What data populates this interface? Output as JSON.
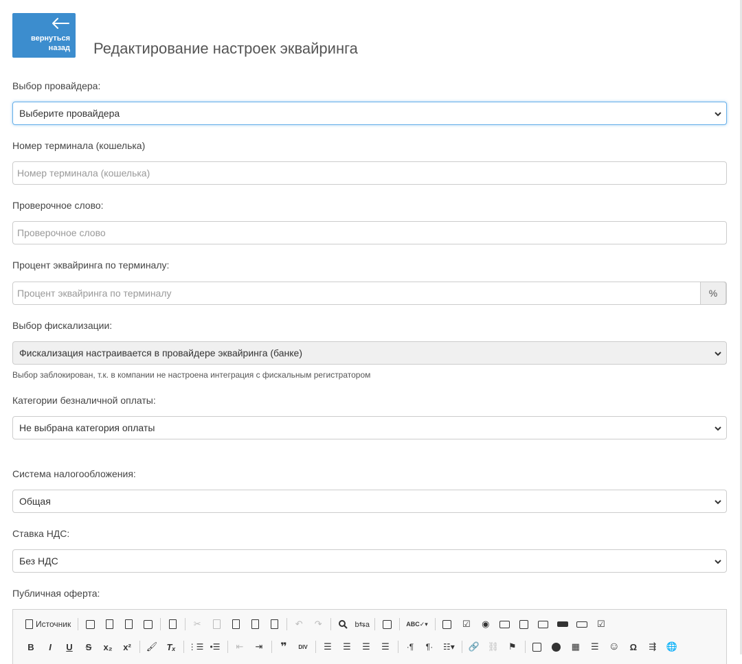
{
  "header": {
    "back_label": "вернуться\nназад",
    "title": "Редактирование настроек эквайринга"
  },
  "form": {
    "provider": {
      "label": "Выбор провайдера:",
      "value": "Выберите провайдера"
    },
    "terminal": {
      "label": "Номер терминала (кошелька)",
      "placeholder": "Номер терминала (кошелька)"
    },
    "secret": {
      "label": "Проверочное слово:",
      "placeholder": "Проверочное слово"
    },
    "percent": {
      "label": "Процент эквайринга по терминалу:",
      "placeholder": "Процент эквайринга по терминалу",
      "addon": "%"
    },
    "fiscal": {
      "label": "Выбор фискализации:",
      "value": "Фискализация настраивается в провайдере эквайринга (банке)",
      "help": "Выбор заблокирован, т.к. в компании не настроена интеграция с фискальным регистратором"
    },
    "category": {
      "label": "Категории безналичной оплаты:",
      "value": "Не выбрана категория оплаты"
    },
    "tax": {
      "label": "Система налогообложения:",
      "value": "Общая"
    },
    "vat": {
      "label": "Ставка НДС:",
      "value": "Без НДС"
    },
    "offer": {
      "label": "Публичная оферта:"
    }
  },
  "editor": {
    "source_label": "Источник",
    "row1_icons": [
      "source-icon",
      "save-icon",
      "new-page-icon",
      "preview-icon",
      "print-icon",
      "templates-icon",
      "cut-icon",
      "copy-icon",
      "paste-icon",
      "paste-text-icon",
      "paste-word-icon",
      "undo-icon",
      "redo-icon",
      "find-icon",
      "replace-icon",
      "select-all-icon",
      "spellcheck-icon",
      "form-icon",
      "checkbox-icon",
      "radio-icon",
      "text-field-icon",
      "textarea-icon",
      "select-field-icon",
      "button-field-icon",
      "image-button-icon",
      "hidden-field-icon"
    ],
    "row2_icons": [
      "bold-icon",
      "italic-icon",
      "underline-icon",
      "strike-icon",
      "subscript-icon",
      "superscript-icon",
      "copy-format-icon",
      "remove-format-icon",
      "numbered-list-icon",
      "bulleted-list-icon",
      "outdent-icon",
      "indent-icon",
      "blockquote-icon",
      "div-icon",
      "align-left-icon",
      "align-center-icon",
      "align-right-icon",
      "justify-icon",
      "ltr-icon",
      "rtl-icon",
      "language-icon",
      "link-icon",
      "unlink-icon",
      "anchor-icon",
      "image-icon",
      "flash-icon",
      "table-icon",
      "horizontal-line-icon",
      "smiley-icon",
      "special-char-icon",
      "page-break-icon",
      "iframe-icon"
    ],
    "glyphs": {
      "bold": "B",
      "italic": "I",
      "underline": "U",
      "strike": "S",
      "subscript": "x₂",
      "superscript": "x²",
      "remove_format": "Tₓ",
      "blockquote": "❞",
      "div": "DIV",
      "ltr": "·¶",
      "rtl": "¶·",
      "special_char": "Ω",
      "smiley": "☺",
      "find": "🔍"
    }
  }
}
